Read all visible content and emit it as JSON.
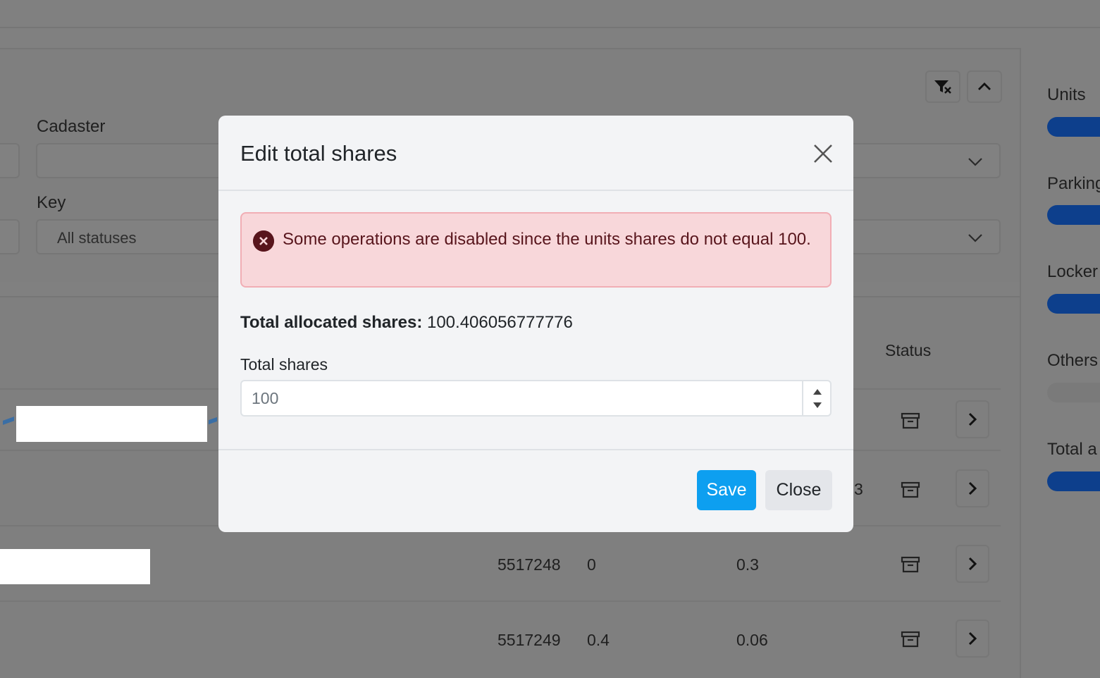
{
  "background": {
    "filters": {
      "cadaster_label": "Cadaster",
      "key_label": "Key",
      "key_value": "All statuses"
    },
    "table": {
      "status_header": "Status",
      "rows": [
        {
          "number": "",
          "col2": "",
          "col3": ""
        },
        {
          "number": "",
          "col2": "",
          "col3": "3"
        },
        {
          "number": "5517248",
          "col2": "0",
          "col3": "0.3"
        },
        {
          "number": "5517249",
          "col2": "0.4",
          "col3": "0.06"
        }
      ]
    },
    "sidebar": {
      "items": [
        {
          "label": "Units"
        },
        {
          "label": "Parking"
        },
        {
          "label": "Locker"
        },
        {
          "label": "Others"
        },
        {
          "label": "Total a"
        }
      ]
    }
  },
  "modal": {
    "title": "Edit total shares",
    "alert_message": "Some operations are disabled since the units shares do not equal 100.",
    "allocated_label": "Total allocated shares:",
    "allocated_value": "100.406056777776",
    "total_shares_label": "Total shares",
    "total_shares_value": "100",
    "save_label": "Save",
    "close_label": "Close"
  },
  "colors": {
    "overlay": "#808080",
    "primary": "#0d9ff0",
    "alert_bg": "#f8d7da",
    "alert_text": "#58151c",
    "sidebar_bar": "#0d3f8c"
  },
  "icons": {
    "filter_clear": "filter-clear-icon",
    "collapse": "chevron-up-icon",
    "archive": "archive-icon",
    "row_open": "chevron-right-icon",
    "alert": "error-circle-icon",
    "modal_close": "close-icon"
  }
}
